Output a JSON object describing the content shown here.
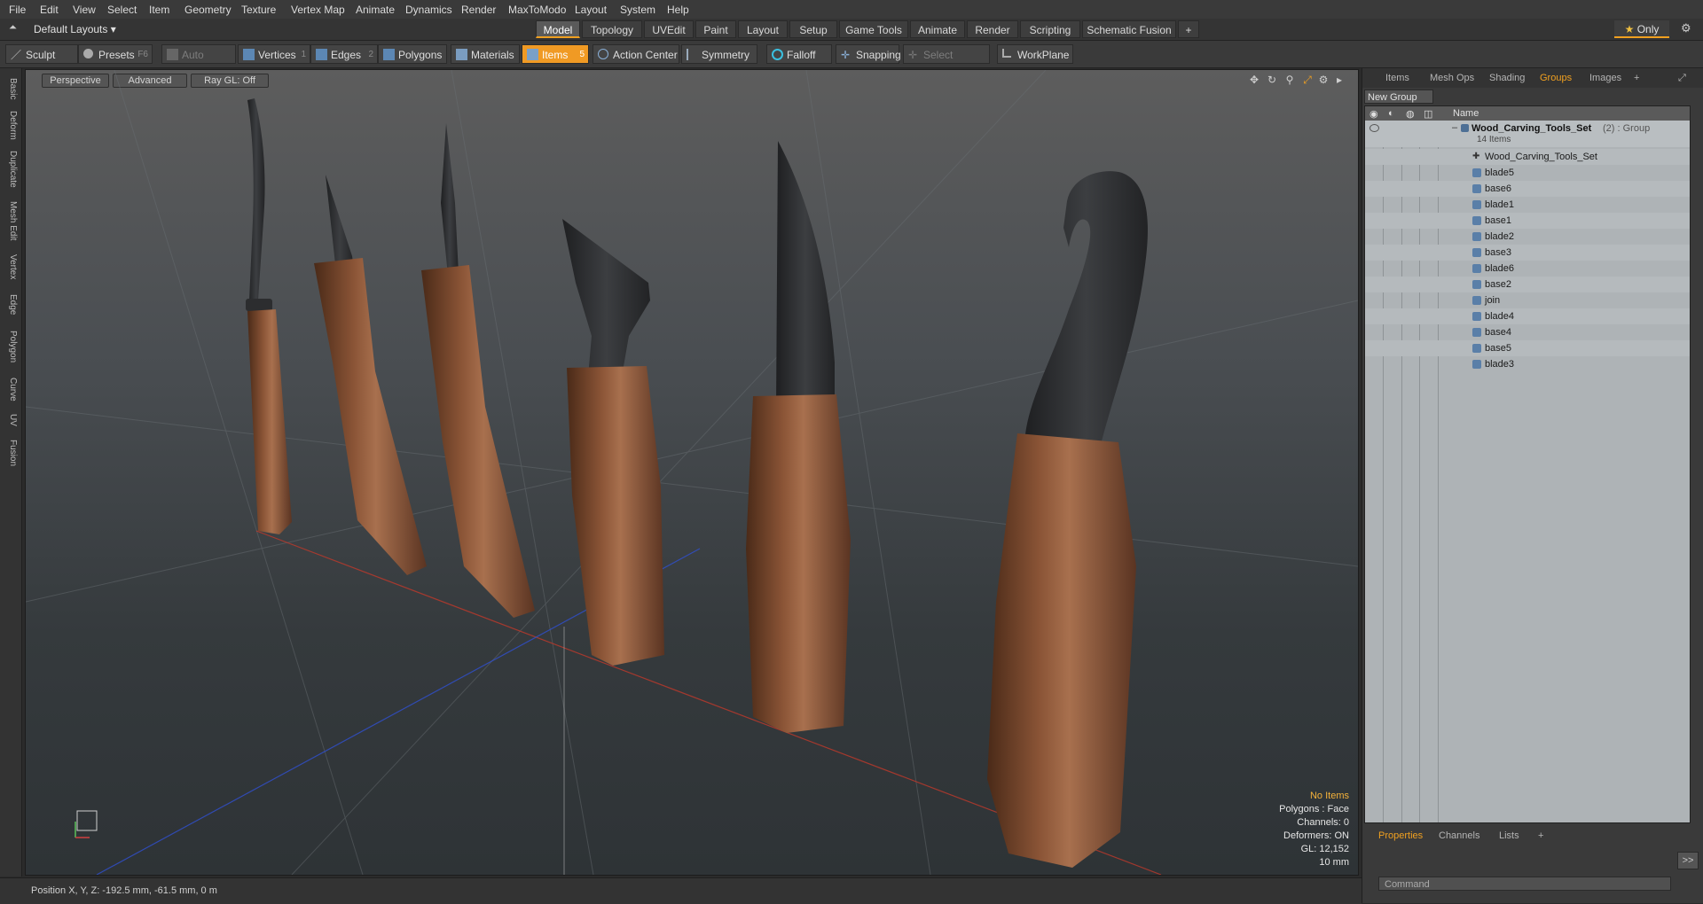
{
  "menu": [
    "File",
    "Edit",
    "View",
    "Select",
    "Item",
    "Geometry",
    "Texture",
    "Vertex Map",
    "Animate",
    "Dynamics",
    "Render",
    "MaxToModo",
    "Layout",
    "System",
    "Help"
  ],
  "layout": {
    "dropdown": "Default Layouts",
    "tabs": [
      "Model",
      "Topology",
      "UVEdit",
      "Paint",
      "Layout",
      "Setup",
      "Game Tools",
      "Animate",
      "Render",
      "Scripting",
      "Schematic Fusion"
    ],
    "active": "Model",
    "only_label": "Only"
  },
  "toolbar": {
    "sculpt": "Sculpt",
    "presets": "Presets",
    "presets_key": "F6",
    "auto_select": "Auto Select",
    "vertices": "Vertices",
    "vertices_key": "1",
    "edges": "Edges",
    "edges_key": "2",
    "polygons": "Polygons",
    "materials": "Materials",
    "items": "Items",
    "items_key": "5",
    "action_center": "Action Center",
    "symmetry": "Symmetry",
    "falloff": "Falloff",
    "snapping": "Snapping",
    "select_through": "Select Through",
    "workplane": "WorkPlane"
  },
  "side_tabs": [
    "Basic",
    "Deform",
    "Duplicate",
    "Mesh Edit",
    "Vertex",
    "Edge",
    "Polygon",
    "Curve",
    "UV",
    "Fusion"
  ],
  "viewport": {
    "view": "Perspective",
    "shading": "Advanced",
    "raygl": "Ray GL: Off",
    "stats": {
      "items": "No Items",
      "polygons": "Polygons : Face",
      "channels": "Channels: 0",
      "deformers": "Deformers: ON",
      "gl": "GL: 12,152",
      "scale": "10 mm"
    }
  },
  "status": {
    "position": "Position X, Y, Z:  -192.5 mm, -61.5 mm, 0 m"
  },
  "right_panel": {
    "tabs": [
      "Items",
      "Mesh Ops",
      "Shading",
      "Groups",
      "Images"
    ],
    "active_tab": "Groups",
    "new_group": "New Group",
    "name_header": "Name",
    "group": {
      "name": "Wood_Carving_Tools_Set",
      "count_suffix": "(2) : Group",
      "items": "14 Items"
    },
    "rows": [
      "Wood_Carving_Tools_Set",
      "blade5",
      "base6",
      "blade1",
      "base1",
      "blade2",
      "base3",
      "blade6",
      "base2",
      "join",
      "blade4",
      "base4",
      "base5",
      "blade3"
    ]
  },
  "bottom_panel": {
    "tabs": [
      "Properties",
      "Channels",
      "Lists"
    ],
    "active": "Properties",
    "command_placeholder": "Command",
    "go": ">>"
  },
  "colors": {
    "accent": "#f0a020",
    "wood": "#7a4a2c",
    "blade": "#2f3032"
  }
}
